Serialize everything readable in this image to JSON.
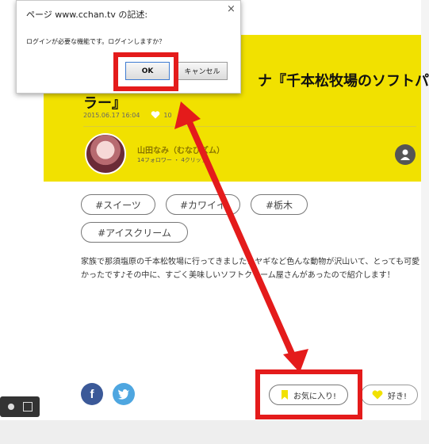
{
  "article": {
    "title_line1": "ナ『千本松牧場のソフトパー",
    "title_line2": "ラー』",
    "date": "2015.06.17 16:04",
    "like_count": "10"
  },
  "author": {
    "name": "山田なみ（むなびズム）",
    "stats": "14フォロワー ・ 4クリップ"
  },
  "tags": [
    "#スイーツ",
    "#カワイイ",
    "#栃木",
    "#アイスクリーム"
  ],
  "description": "家族で那須塩原の千本松牧場に行ってきました！ヤギなど色んな動物が沢山いて、とっても可愛かったです♪その中に、すごく美味しいソフトクリーム屋さんがあったので紹介します！",
  "actions": {
    "favorite_label": "お気に入り!",
    "like_label": "好き!"
  },
  "dialog": {
    "title": "ページ www.cchan.tv の記述:",
    "message": "ログインが必要な機能です。ログインしますか？",
    "ok_label": "OK",
    "cancel_label": "キャンセル",
    "close_glyph": "×"
  },
  "colors": {
    "hero_yellow": "#f1e100",
    "annotation_red": "#e41b1b",
    "facebook": "#3b5998",
    "twitter": "#4ea6e0"
  },
  "icons": {
    "facebook": "f",
    "twitter": "🐦"
  }
}
